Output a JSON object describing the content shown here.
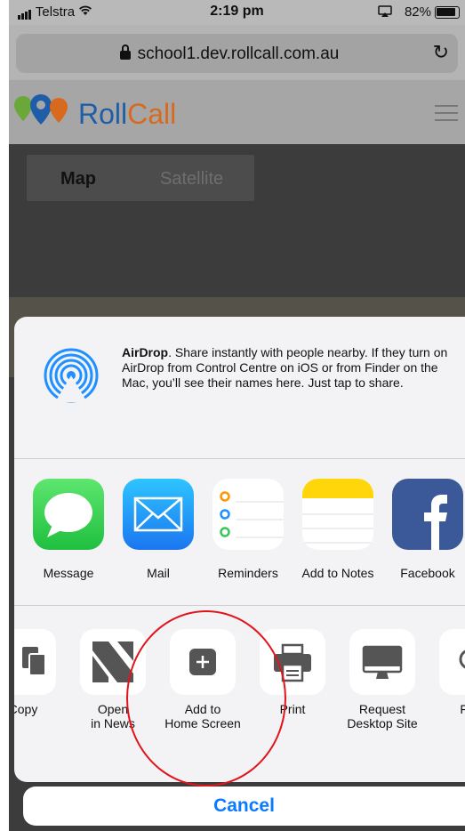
{
  "status_bar": {
    "carrier": "Telstra",
    "time": "2:19 pm",
    "battery": "82%"
  },
  "browser": {
    "url": "school1.dev.rollcall.com.au"
  },
  "site": {
    "brand_roll": "Roll",
    "brand_call": "Call"
  },
  "map": {
    "map_label": "Map",
    "satellite_label": "Satellite"
  },
  "share_sheet": {
    "airdrop_title": "AirDrop",
    "airdrop_text": ". Share instantly with people nearby. If they turn on AirDrop from Control Centre on iOS or from Finder on the Mac, you’ll see their names here. Just tap to share.",
    "apps": [
      {
        "label": "Message"
      },
      {
        "label": "Mail"
      },
      {
        "label": "Reminders"
      },
      {
        "label": "Add to Notes"
      },
      {
        "label": "Facebook"
      }
    ],
    "actions": [
      {
        "label": "Copy"
      },
      {
        "label": "Open\nin News"
      },
      {
        "label": "Add to\nHome Screen"
      },
      {
        "label": "Print"
      },
      {
        "label": "Request\nDesktop Site"
      },
      {
        "label": "Find"
      }
    ],
    "cancel_label": "Cancel"
  },
  "colors": {
    "ios_blue": "#0a7aff",
    "annotation_red": "#e2141b",
    "message_green": "#35c759",
    "mail_blue": "#1e90ff",
    "facebook_blue": "#3b5998",
    "notes_yellow": "#ffd60a"
  }
}
